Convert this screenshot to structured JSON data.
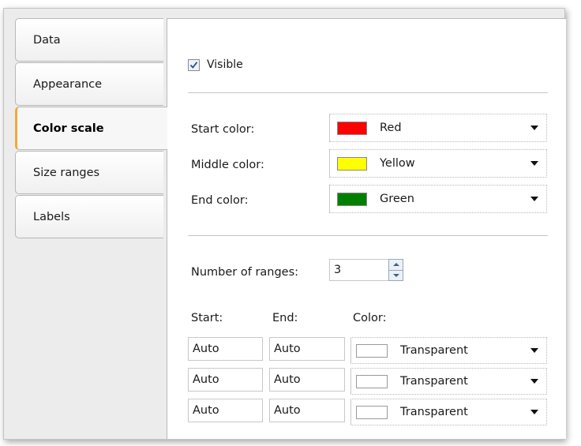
{
  "tabs": [
    {
      "label": "Data",
      "active": false
    },
    {
      "label": "Appearance",
      "active": false
    },
    {
      "label": "Color scale",
      "active": true
    },
    {
      "label": "Size ranges",
      "active": false
    },
    {
      "label": "Labels",
      "active": false
    }
  ],
  "visible": {
    "label": "Visible",
    "checked": true
  },
  "colors": {
    "start": {
      "label": "Start color:",
      "value": "Red",
      "swatch": "#ff0000"
    },
    "middle": {
      "label": "Middle color:",
      "value": "Yellow",
      "swatch": "#ffff00"
    },
    "end": {
      "label": "End color:",
      "value": "Green",
      "swatch": "#008000"
    }
  },
  "ranges": {
    "count_label": "Number of ranges:",
    "count": "3",
    "headers": {
      "start": "Start:",
      "end": "End:",
      "color": "Color:"
    },
    "rows": [
      {
        "start": "Auto",
        "end": "Auto",
        "color": "Transparent"
      },
      {
        "start": "Auto",
        "end": "Auto",
        "color": "Transparent"
      },
      {
        "start": "Auto",
        "end": "Auto",
        "color": "Transparent"
      }
    ]
  },
  "theme": {
    "active_tab_accent": "#f1a93a"
  }
}
